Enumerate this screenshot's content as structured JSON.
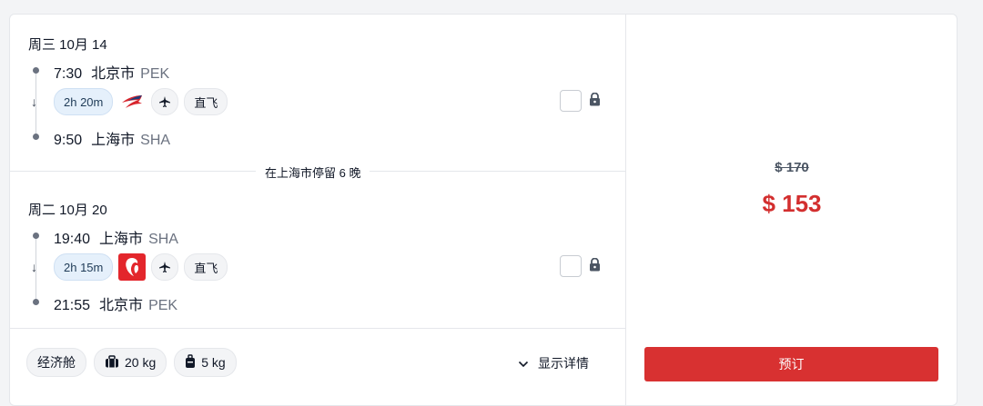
{
  "outbound": {
    "date": "周三 10月 14",
    "dep_time": "7:30",
    "dep_city": "北京市",
    "dep_code": "PEK",
    "duration": "2h 20m",
    "airline_icon": "china-eastern-logo",
    "direct": "直飞",
    "arr_time": "9:50",
    "arr_city": "上海市",
    "arr_code": "SHA"
  },
  "stay": "在上海市停留 6 晚",
  "return": {
    "date": "周二 10月 20",
    "dep_time": "19:40",
    "dep_city": "上海市",
    "dep_code": "SHA",
    "duration": "2h 15m",
    "airline_icon": "air-china-logo",
    "direct": "直飞",
    "arr_time": "21:55",
    "arr_city": "北京市",
    "arr_code": "PEK"
  },
  "baggage": {
    "cabin_class": "经济舱",
    "checked": "20 kg",
    "carry_on": "5 kg"
  },
  "details_label": "显示详情",
  "price": {
    "original": "$ 170",
    "current": "$ 153"
  },
  "book_label": "预订",
  "colors": {
    "accent": "#d83131",
    "price": "#d32f2f"
  }
}
